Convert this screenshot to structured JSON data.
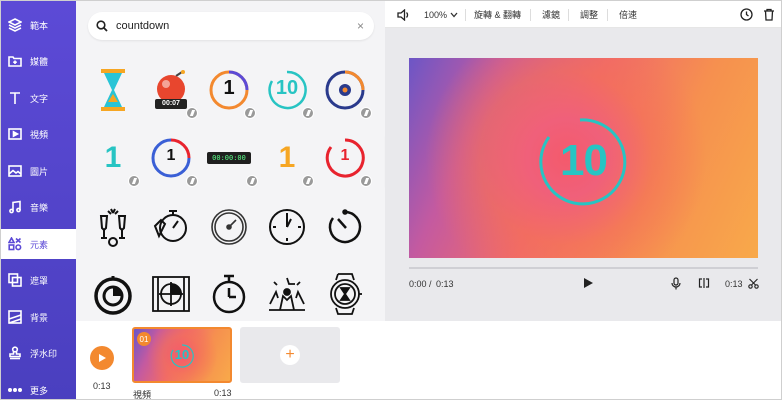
{
  "sidebar": {
    "items": [
      {
        "label": "範本",
        "icon": "layers-icon"
      },
      {
        "label": "媒體",
        "icon": "folder-plus-icon"
      },
      {
        "label": "文字",
        "icon": "text-icon"
      },
      {
        "label": "視頻",
        "icon": "video-icon"
      },
      {
        "label": "圖片",
        "icon": "image-icon"
      },
      {
        "label": "音樂",
        "icon": "music-icon"
      },
      {
        "label": "元素",
        "icon": "shapes-icon",
        "active": true
      },
      {
        "label": "遮罩",
        "icon": "overlay-icon"
      },
      {
        "label": "背景",
        "icon": "background-icon"
      },
      {
        "label": "浮水印",
        "icon": "stamp-icon"
      },
      {
        "label": "更多",
        "icon": "more-icon"
      }
    ]
  },
  "search": {
    "value": "countdown",
    "clear": "×"
  },
  "elements": {
    "digits": {
      "r1c2": "00:07",
      "r1c3": "1",
      "r1c4": "10",
      "r2c1": "1",
      "r2c2": "1",
      "r2c3": "00:00:00",
      "r2c4": "1",
      "r2c5": "1"
    }
  },
  "toolbar": {
    "zoom": "100%",
    "rotate_flip": "旋轉 & 翻轉",
    "filter": "濾鏡",
    "adjust": "調整",
    "speed": "倍速"
  },
  "canvas": {
    "countdown_number": "10"
  },
  "player": {
    "current_time": "0:00",
    "total_time": "0:13",
    "separator": "/",
    "clip_duration": "0:13"
  },
  "timeline": {
    "total_time": "0:13",
    "clip": {
      "index": "01",
      "label": "視頻",
      "duration": "0:13",
      "thumb_number": "10"
    },
    "add_label": "+"
  },
  "colors": {
    "sidebar": "#5c4ad6",
    "accent": "#f3892f",
    "teal": "#27c4c3",
    "red": "#e8232e"
  }
}
